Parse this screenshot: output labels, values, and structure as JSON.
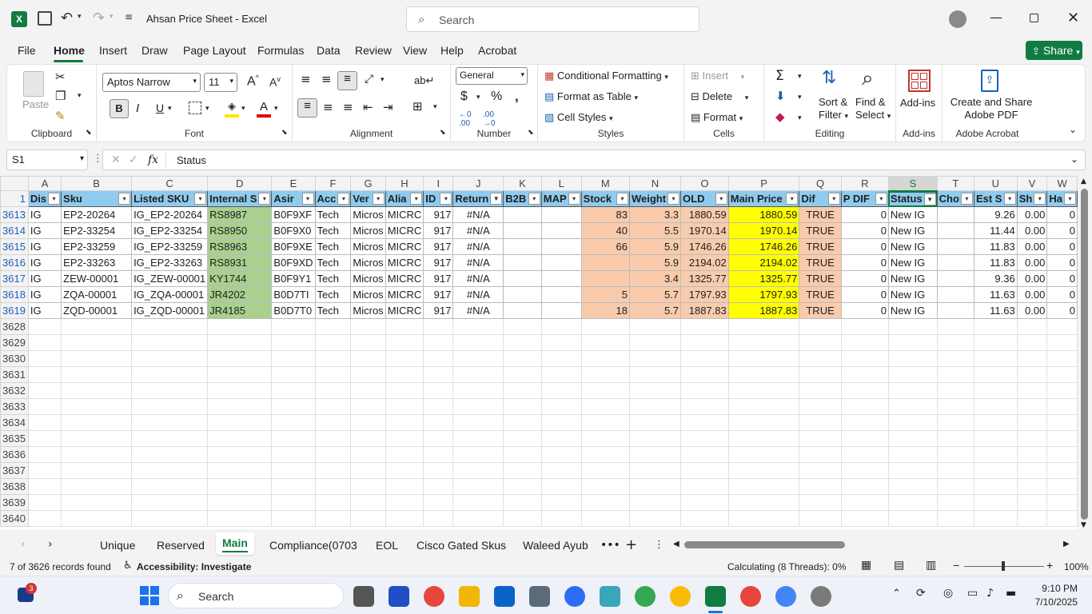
{
  "titlebar": {
    "doc_title": "Ahsan Price Sheet  -  Excel",
    "search_placeholder": "Search"
  },
  "menu": {
    "items": [
      "File",
      "Home",
      "Insert",
      "Draw",
      "Page Layout",
      "Formulas",
      "Data",
      "Review",
      "View",
      "Help",
      "Acrobat"
    ],
    "active": "Home",
    "share_label": "Share"
  },
  "ribbon": {
    "clipboard": {
      "paste": "Paste",
      "label": "Clipboard"
    },
    "font": {
      "name": "Aptos Narrow",
      "size": "11",
      "label": "Font"
    },
    "alignment": {
      "label": "Alignment"
    },
    "number": {
      "format": "General",
      "label": "Number"
    },
    "styles": {
      "conditional": "Conditional Formatting",
      "format_table": "Format as Table",
      "cell_styles": "Cell Styles",
      "label": "Styles"
    },
    "cells": {
      "insert": "Insert",
      "delete": "Delete",
      "format": "Format",
      "label": "Cells"
    },
    "editing": {
      "sort1": "Sort &",
      "sort2": "Filter",
      "find1": "Find &",
      "find2": "Select",
      "label": "Editing"
    },
    "addins": {
      "btn": "Add-ins",
      "label": "Add-ins"
    },
    "acrobat": {
      "btn1": "Create and Share",
      "btn2": "Adobe PDF",
      "label": "Adobe Acrobat"
    }
  },
  "formula_bar": {
    "name_box": "S1",
    "fx": "fx",
    "content": "Status"
  },
  "sheet": {
    "col_letters": [
      "A",
      "B",
      "C",
      "D",
      "E",
      "F",
      "G",
      "H",
      "I",
      "J",
      "K",
      "L",
      "M",
      "N",
      "O",
      "P",
      "Q",
      "R",
      "S",
      "T",
      "U",
      "V",
      "W"
    ],
    "header_row_num": "1",
    "headers": [
      "Dis",
      "Sku",
      "Listed SKU",
      "Internal S",
      "Asir",
      "Acc",
      "Ver",
      "Alia",
      "ID",
      "Return",
      "B2B",
      "MAP",
      "Stock",
      "Weight",
      "OLD",
      "Main Price",
      "Dif",
      "P DIF",
      "Status",
      "Cho",
      "Est S",
      "Sh",
      "Ha"
    ],
    "rows": [
      {
        "n": "3613",
        "cells": [
          "IG",
          "EP2-20264",
          "IG_EP2-20264",
          "RS8987",
          "B0F9XF",
          "Tech",
          "Micros",
          "MICRC",
          "917",
          "#N/A",
          "",
          "",
          "83",
          "3.3",
          "1880.59",
          "1880.59",
          "TRUE",
          "0",
          "New IG",
          "",
          "9.26",
          "0.00",
          "0"
        ]
      },
      {
        "n": "3614",
        "cells": [
          "IG",
          "EP2-33254",
          "IG_EP2-33254",
          "RS8950",
          "B0F9X0",
          "Tech",
          "Micros",
          "MICRC",
          "917",
          "#N/A",
          "",
          "",
          "40",
          "5.5",
          "1970.14",
          "1970.14",
          "TRUE",
          "0",
          "New IG",
          "",
          "11.44",
          "0.00",
          "0"
        ]
      },
      {
        "n": "3615",
        "cells": [
          "IG",
          "EP2-33259",
          "IG_EP2-33259",
          "RS8963",
          "B0F9XE",
          "Tech",
          "Micros",
          "MICRC",
          "917",
          "#N/A",
          "",
          "",
          "66",
          "5.9",
          "1746.26",
          "1746.26",
          "TRUE",
          "0",
          "New IG",
          "",
          "11.83",
          "0.00",
          "0"
        ]
      },
      {
        "n": "3616",
        "cells": [
          "IG",
          "EP2-33263",
          "IG_EP2-33263",
          "RS8931",
          "B0F9XD",
          "Tech",
          "Micros",
          "MICRC",
          "917",
          "#N/A",
          "",
          "",
          "",
          "5.9",
          "2194.02",
          "2194.02",
          "TRUE",
          "0",
          "New IG",
          "",
          "11.83",
          "0.00",
          "0"
        ]
      },
      {
        "n": "3617",
        "cells": [
          "IG",
          "ZEW-00001",
          "IG_ZEW-00001",
          "KY1744",
          "B0F9Y1",
          "Tech",
          "Micros",
          "MICRC",
          "917",
          "#N/A",
          "",
          "",
          "",
          "3.4",
          "1325.77",
          "1325.77",
          "TRUE",
          "0",
          "New IG",
          "",
          "9.36",
          "0.00",
          "0"
        ]
      },
      {
        "n": "3618",
        "cells": [
          "IG",
          "ZQA-00001",
          "IG_ZQA-00001",
          "JR4202",
          "B0D7TI",
          "Tech",
          "Micros",
          "MICRC",
          "917",
          "#N/A",
          "",
          "",
          "5",
          "5.7",
          "1797.93",
          "1797.93",
          "TRUE",
          "0",
          "New IG",
          "",
          "11.63",
          "0.00",
          "0"
        ]
      },
      {
        "n": "3619",
        "cells": [
          "IG",
          "ZQD-00001",
          "IG_ZQD-00001",
          "JR4185",
          "B0D7T0",
          "Tech",
          "Micros",
          "MICRC",
          "917",
          "#N/A",
          "",
          "",
          "18",
          "5.7",
          "1887.83",
          "1887.83",
          "TRUE",
          "0",
          "New IG",
          "",
          "11.63",
          "0.00",
          "0"
        ]
      }
    ],
    "empty_rows": [
      "3628",
      "3629",
      "3630",
      "3631",
      "3632",
      "3633",
      "3634",
      "3635",
      "3636",
      "3637",
      "3638",
      "3639",
      "3640"
    ]
  },
  "tabs": {
    "items": [
      "Unique",
      "Reserved",
      "Main",
      "Compliance(0703",
      "EOL",
      "Cisco Gated Skus",
      "Waleed Ayub"
    ],
    "active": "Main"
  },
  "status": {
    "records": "7 of 3626 records found",
    "accessibility": "Accessibility: Investigate",
    "calc": "Calculating (8 Threads): 0%",
    "zoom": "100%"
  },
  "taskbar": {
    "search": "Search",
    "time": "9:10 PM",
    "date": "7/10/2025",
    "badge": "3"
  }
}
